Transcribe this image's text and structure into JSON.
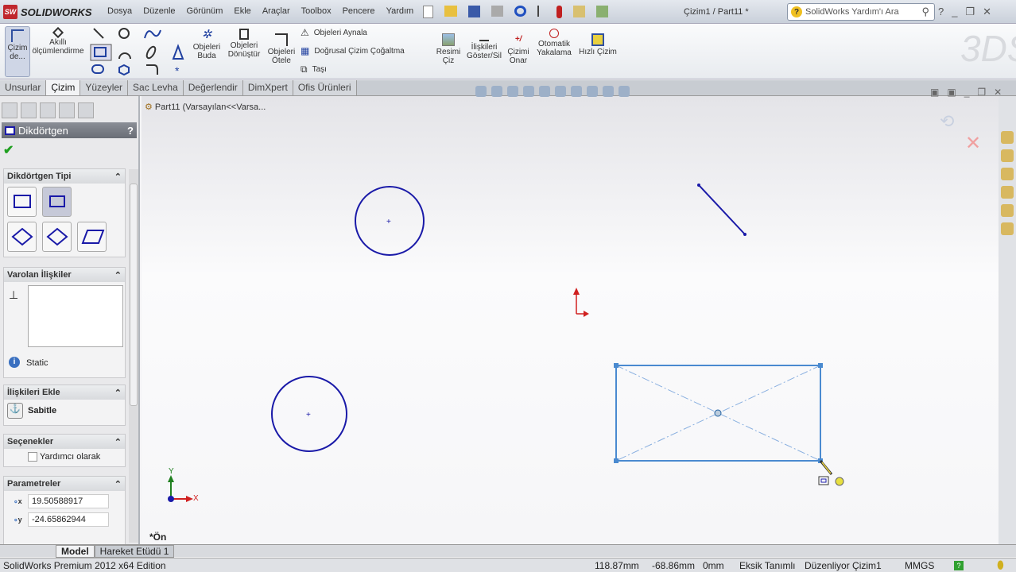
{
  "app": {
    "brand": "SOLIDWORKS",
    "doc_title": "Çizim1 / Part11 *"
  },
  "menu": [
    "Dosya",
    "Düzenle",
    "Görünüm",
    "Ekle",
    "Araçlar",
    "Toolbox",
    "Pencere",
    "Yardım"
  ],
  "search": {
    "placeholder": "SolidWorks Yardım'ı Ara"
  },
  "ribbon": {
    "sketch": "Çizim de...",
    "smart_dim": "Akıllı ölçümlendirme",
    "trim": "Objeleri Buda",
    "convert": "Objeleri Dönüştür",
    "offset": "Objeleri Ötele",
    "mirror": "Objeleri Aynala",
    "linear_pattern": "Doğrusal Çizim Çoğaltma",
    "move": "Taşı",
    "sketch_picture": "Resimi Çiz",
    "relations": "İlişkileri Göster/Sil",
    "repair": "Çizimi Onar",
    "snap": "Otomatik Yakalama",
    "rapid": "Hızlı Çizim"
  },
  "tabs": [
    "Unsurlar",
    "Çizim",
    "Yüzeyler",
    "Sac Levha",
    "Değerlendir",
    "DimXpert",
    "Ofis Ürünleri"
  ],
  "active_tab": "Çizim",
  "property_manager": {
    "title": "Dikdörtgen",
    "help": "?",
    "rect_type_title": "Dikdörtgen Tipi",
    "existing_relations_title": "Varolan İlişkiler",
    "status_text": "Static",
    "add_relations_title": "İlişkileri Ekle",
    "fix_label": "Sabitle",
    "options_title": "Seçenekler",
    "construction_label": "Yardımcı olarak",
    "construction_checked": false,
    "params_title": "Parametreler",
    "x_label": "x",
    "y_label": "y",
    "x_value": "19.50588917",
    "y_value": "-24.65862944"
  },
  "breadcrumb": "Part11  (Varsayılan<<Varsa...",
  "view_label": "*Ön",
  "triad": {
    "x": "X",
    "y": "Y"
  },
  "bottom_tabs": [
    "Model",
    "Hareket Etüdü 1"
  ],
  "status": {
    "edition": "SolidWorks Premium 2012 x64 Edition",
    "x": "118.87mm",
    "y": "-68.86mm",
    "z": "0mm",
    "definition": "Eksik Tanımlı",
    "editing": "Düzenliyor Çizim1",
    "units": "MMGS"
  },
  "colors": {
    "sketch": "#1a1aa8",
    "selected": "#4a8ad0",
    "accent": "#c0272d"
  }
}
